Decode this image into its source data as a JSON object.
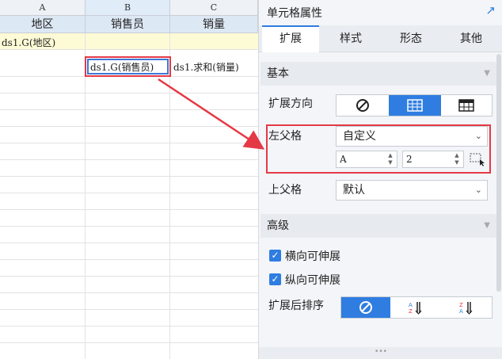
{
  "sheet": {
    "columns": [
      "A",
      "B",
      "C"
    ],
    "header_row": [
      "地区",
      "销售员",
      "销量"
    ],
    "row2": {
      "a": "ds1.G(地区)"
    },
    "row3": {
      "b": "ds1.G(销售员)",
      "c": "ds1.求和(销量)"
    }
  },
  "panel": {
    "title": "单元格属性",
    "pin_icon": "pin-icon",
    "tabs": [
      "扩展",
      "样式",
      "形态",
      "其他"
    ],
    "active_tab": "扩展",
    "basic": {
      "section_label": "基本",
      "expand_direction_label": "扩展方向",
      "left_parent_label": "左父格",
      "left_parent_value": "自定义",
      "left_parent_col": "A",
      "left_parent_row": "2",
      "up_parent_label": "上父格",
      "up_parent_value": "默认"
    },
    "advanced": {
      "section_label": "高级",
      "horizontal_label": "横向可伸展",
      "vertical_label": "纵向可伸展",
      "sort_label": "扩展后排序"
    }
  },
  "colors": {
    "accent": "#2f7de1",
    "highlight": "#e53946",
    "row_yellow": "#fdfbd6",
    "header_blue": "#dde8f5"
  }
}
